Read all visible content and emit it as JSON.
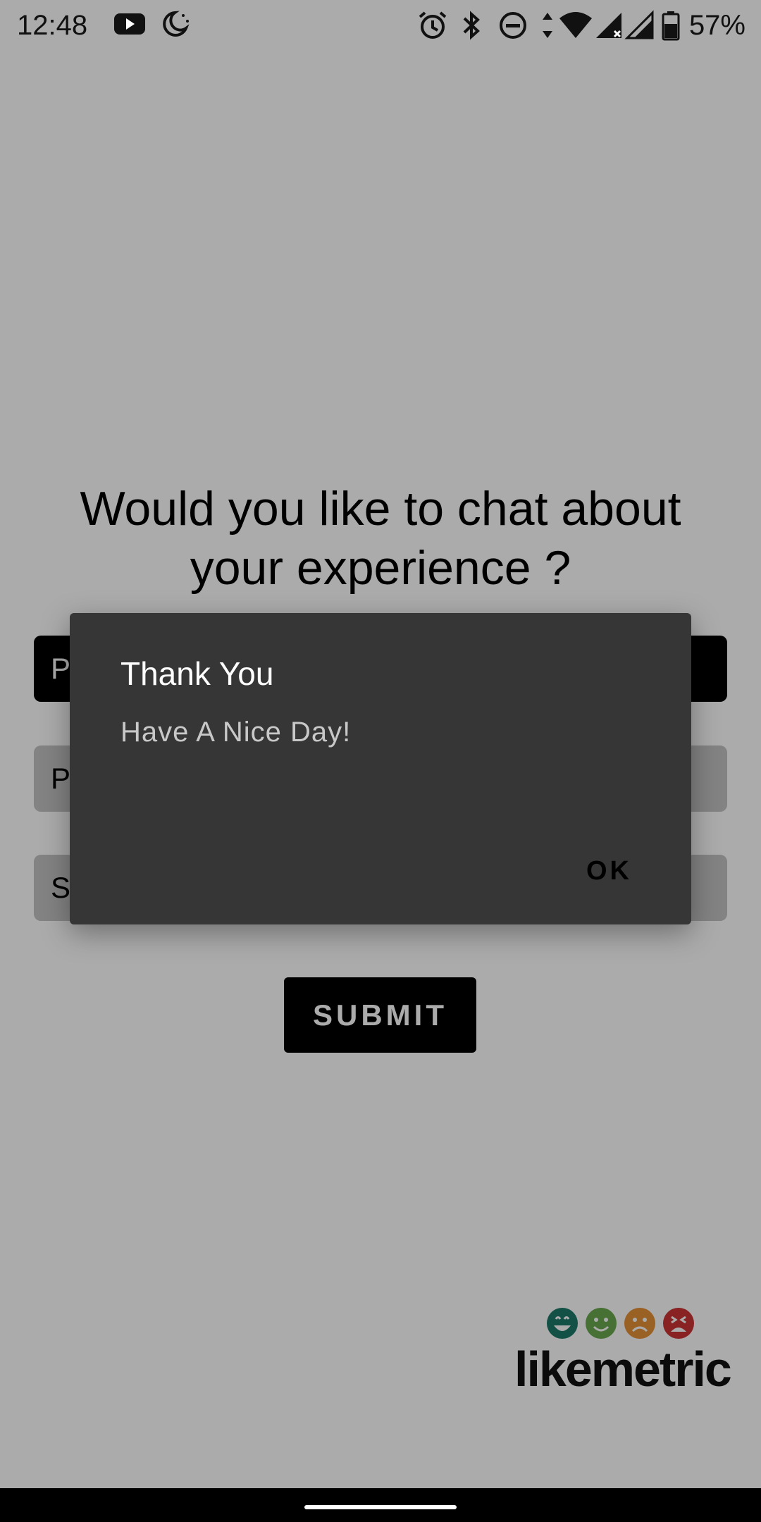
{
  "status_bar": {
    "time": "12:48",
    "battery": "57%",
    "icons_left": [
      "youtube-icon",
      "night-mode-icon"
    ],
    "icons_right": [
      "alarm-icon",
      "bluetooth-icon",
      "do-not-disturb-icon",
      "data-arrows-icon",
      "wifi-icon",
      "signal-icon",
      "signal-icon",
      "battery-icon"
    ]
  },
  "page": {
    "question": "Would you like to chat about your experience ?",
    "options": [
      {
        "label": "P",
        "selected": true
      },
      {
        "label": "P",
        "selected": false
      },
      {
        "label": "S",
        "selected": false
      }
    ],
    "submit_label": "SUBMIT",
    "brand": "likemetric",
    "brand_face_colors": [
      "#1d7a6a",
      "#6aa84f",
      "#e69138",
      "#cc3333"
    ]
  },
  "dialog": {
    "title": "Thank You",
    "message": "Have A Nice Day!",
    "ok_label": "OK"
  },
  "colors": {
    "dialog_bg": "#363636",
    "scrim": "rgba(0,0,0,0.33)",
    "primary": "#000000"
  }
}
